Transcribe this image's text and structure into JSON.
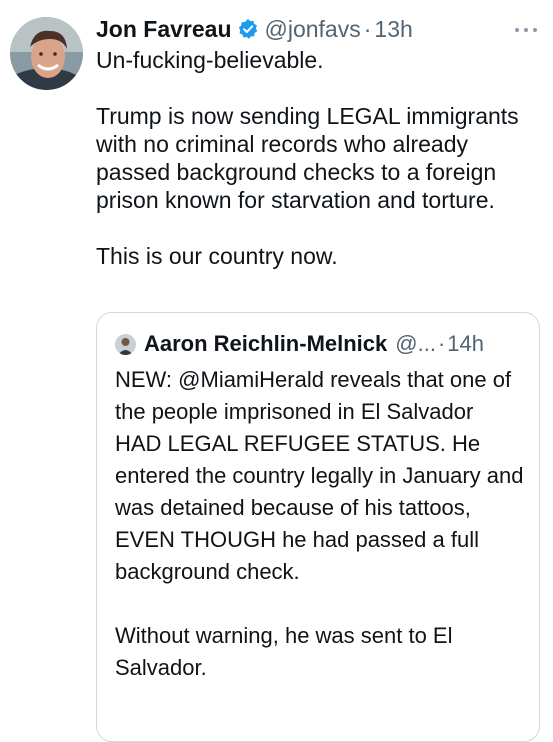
{
  "tweet": {
    "display_name": "Jon Favreau",
    "handle": "@jonfavs",
    "separator": "·",
    "time": "13h",
    "paragraphs": [
      "Un-fucking-believable.",
      "Trump is now sending LEGAL immigrants with no criminal records who already passed background checks to a foreign prison known for starvation and torture.",
      "This is our country now."
    ],
    "verified_color": "#1d9bf0",
    "avatar_icon": "profile-photo",
    "more_icon": "more-horizontal-icon"
  },
  "quote": {
    "display_name": "Aaron Reichlin-Melnick",
    "handle": "@...",
    "separator": "·",
    "time": "14h",
    "paragraphs": [
      "NEW: @MiamiHerald reveals that one of the people imprisoned in El Salvador HAD LEGAL REFUGEE STATUS. He entered the country legally in January and was detained because of his tattoos, EVEN THOUGH he had passed a full background check.",
      "Without warning, he was sent to El Salvador."
    ]
  },
  "colors": {
    "text": "#0f1419",
    "secondary": "#536471",
    "border": "#cfd9de"
  }
}
